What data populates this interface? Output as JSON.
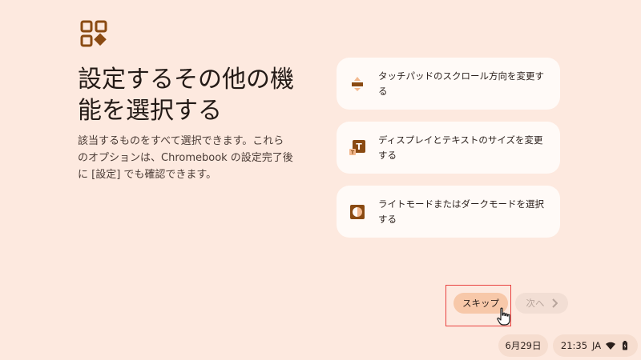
{
  "header": {
    "title": "設定するその他の機能を選択する",
    "description": "該当するものをすべて選択できます。これらのオプションは、Chromebook の設定完了後に [設定] でも確認できます。"
  },
  "options": [
    {
      "icon": "touchpad-scroll-icon",
      "label": "タッチパッドのスクロール方向を変更する"
    },
    {
      "icon": "display-text-size-icon",
      "label": "ディスプレイとテキストのサイズを変更する"
    },
    {
      "icon": "light-dark-mode-icon",
      "label": "ライトモードまたはダークモードを選択する"
    }
  ],
  "buttons": {
    "skip": "スキップ",
    "next": "次へ"
  },
  "shelf": {
    "date": "6月29日",
    "time": "21:35",
    "ime": "JA"
  },
  "colors": {
    "background": "#fde9df",
    "accent": "#8a4a12",
    "card": "#fffaf7",
    "skip_button": "#f7c8a9"
  }
}
